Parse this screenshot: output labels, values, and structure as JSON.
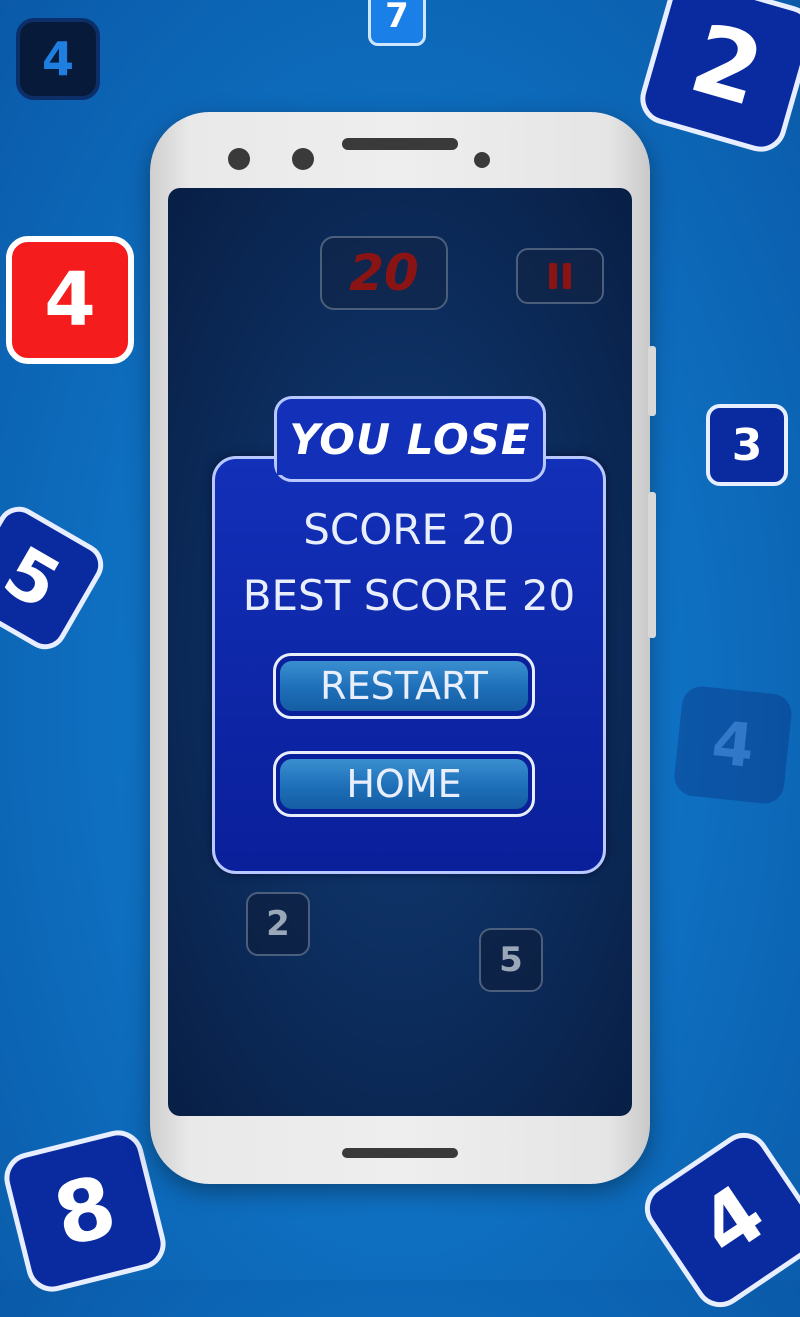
{
  "background_tiles": [
    {
      "value": "4"
    },
    {
      "value": "7"
    },
    {
      "value": "2"
    },
    {
      "value": "4"
    },
    {
      "value": "3"
    },
    {
      "value": "5"
    },
    {
      "value": "4"
    },
    {
      "value": "8"
    },
    {
      "value": "4"
    }
  ],
  "game": {
    "score": "20",
    "pause_icon": "pause-icon",
    "board_tiles": [
      {
        "value": "2"
      },
      {
        "value": "5"
      }
    ]
  },
  "dialog": {
    "title": "YOU LOSE",
    "score_text": "SCORE 20",
    "best_score_text": "BEST SCORE 20",
    "restart_label": "RESTART",
    "home_label": "HOME"
  },
  "colors": {
    "background": "#0f72c4",
    "tile_blue": "#0a2aa0",
    "tile_red": "#f41c1c",
    "score_red": "#8a1414",
    "dialog_blue": "#1230b8"
  }
}
